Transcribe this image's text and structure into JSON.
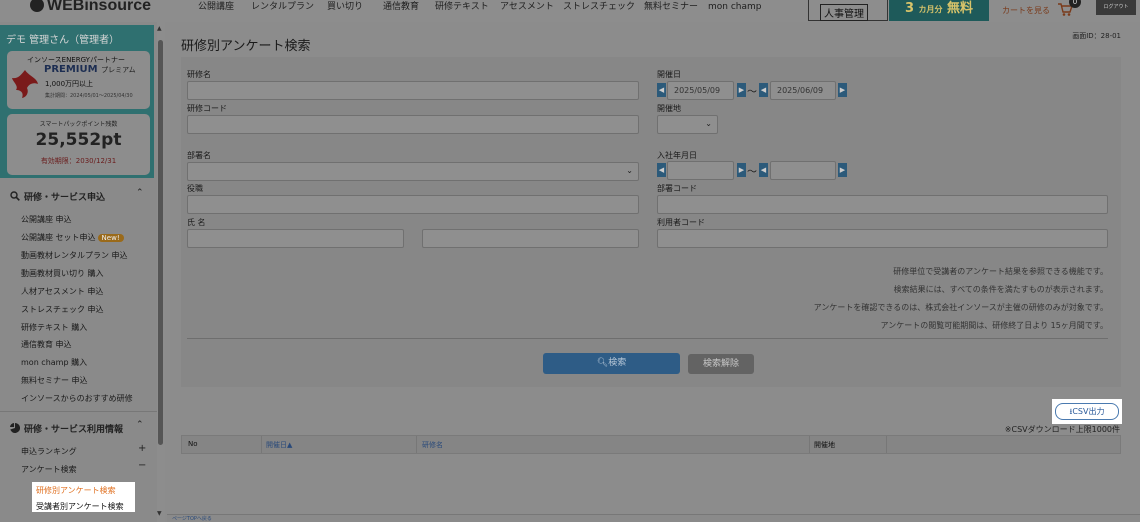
{
  "header": {
    "logo_text": "WEBinsource",
    "nav": [
      {
        "label": "公開講座",
        "sub": ""
      },
      {
        "label": "レンタルプラン",
        "sub": ""
      },
      {
        "label": "買い切り",
        "sub": ""
      },
      {
        "label": "通信教育",
        "sub": ""
      },
      {
        "label": "研修テキスト",
        "sub": ""
      },
      {
        "label": "アセスメント",
        "sub": ""
      },
      {
        "label": "ストレスチェック",
        "sub": ""
      },
      {
        "label": "無料セミナー",
        "sub": ""
      },
      {
        "label": "mon champ",
        "sub": ""
      }
    ],
    "jinji_label": "人事管理",
    "promo_big": "3",
    "promo_small": "カ月分",
    "promo_tail": "無料",
    "cart_label": "カートを見る",
    "cart_count": "0",
    "logout_label": "ログアウト"
  },
  "sidebar": {
    "user": "デモ 管理さん（管理者）",
    "partner_title": "インソースENERGYパートナー",
    "plan_name": "PREMIUM",
    "plan_suffix": "プレミアム",
    "plan_amount": "1,000万円以上",
    "plan_period": "集計期間：2024/05/01〜2025/04/30",
    "points_title": "スマートパックポイント残数",
    "points_value": "25,552pt",
    "points_expiry": "有効期限：2030/12/31",
    "section1_title": "研修・サービス申込",
    "section1_items": [
      "公開講座 申込",
      "公開講座 セット申込",
      "動画教材レンタルプラン 申込",
      "動画教材買い切り 購入",
      "人材アセスメント 申込",
      "ストレスチェック 申込",
      "研修テキスト 購入",
      "通信教育 申込",
      "mon champ 購入",
      "無料セミナー 申込",
      "インソースからのおすすめ研修"
    ],
    "new_badge": "New!",
    "section2_title": "研修・サービス利用情報",
    "section2_items": [
      "申込ランキング",
      "アンケート検索"
    ],
    "submenu": [
      "研修別アンケート検索",
      "受講者別アンケート検索"
    ]
  },
  "main": {
    "screen_id": "画面ID：28-01",
    "title": "研修別アンケート検索",
    "labels": {
      "course_name": "研修名",
      "course_code": "研修コード",
      "date": "開催日",
      "location": "開催地",
      "department": "部署名",
      "join_date": "入社年月日",
      "position": "役職",
      "dept_code": "部署コード",
      "name": "氏 名",
      "user_code": "利用者コード"
    },
    "date_from": "2025/05/09",
    "date_to": "2025/06/09",
    "tilde": "〜",
    "notes": [
      "研修単位で受講者のアンケート結果を参照できる機能です。",
      "検索結果には、すべての条件を満たすものが表示されます。",
      "アンケートを確認できるのは、株式会社インソースが主催の研修のみが対象です。",
      "アンケートの閲覧可能期間は、研修終了日より 15ヶ月間です。"
    ],
    "search_button": "検索",
    "clear_button": "検索解除",
    "csv_button": "CSV出力",
    "csv_note": "※CSVダウンロード上限1000件",
    "table_headers": [
      "No",
      "開催日▲",
      "研修名",
      "開催地"
    ],
    "bottom_link": "ページTOPへ戻る"
  }
}
